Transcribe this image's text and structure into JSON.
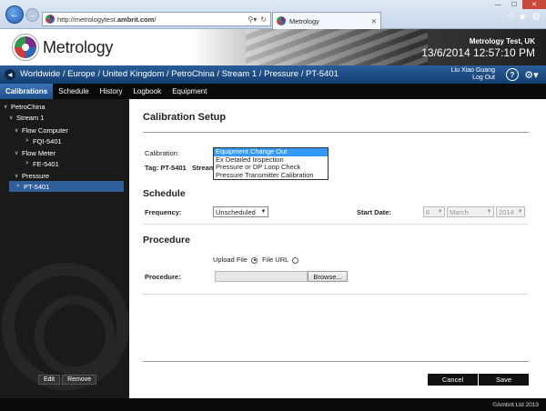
{
  "browser": {
    "url_prefix": "http://metrologytest.",
    "url_domain": "ambrit.com",
    "url_suffix": "/",
    "tab_title": "Metrology"
  },
  "header": {
    "logo_text": "Metrology",
    "site_name": "Metrology Test, UK",
    "datetime": "13/6/2014  12:57:10 PM"
  },
  "breadcrumb": {
    "path": "Worldwide / Europe / United Kingdom / PetroChina / Stream 1 / Pressure / PT-5401"
  },
  "user": {
    "name": "Liu Xiao Guang",
    "logout": "Log Out"
  },
  "nav": {
    "tabs": [
      "Calibrations",
      "Schedule",
      "History",
      "Logbook",
      "Equipment"
    ]
  },
  "tree": {
    "items": [
      {
        "label": "PetroChina",
        "chev": "∨"
      },
      {
        "label": "Stream 1",
        "chev": "∨"
      },
      {
        "label": "Flow Computer",
        "chev": "∨"
      },
      {
        "label": "FQI-5401",
        "chev": ">"
      },
      {
        "label": "Flow Meter",
        "chev": "∨"
      },
      {
        "label": "FE-5401",
        "chev": ">"
      },
      {
        "label": "Pressure",
        "chev": "∨"
      },
      {
        "label": "PT-5401",
        "chev": ">"
      }
    ],
    "edit_label": "Edit",
    "remove_label": "Remove"
  },
  "form": {
    "title": "Calibration Setup",
    "calibration_label": "Calibration:",
    "calibration_options": [
      "Equipment Change Out",
      "Ex Detailed Inspection",
      "Pressure or DP Loop Check",
      "Pressure Transmitter Calibration"
    ],
    "tag_text": "Tag: PT-5401",
    "stream_text": "Stream",
    "schedule_title": "Schedule",
    "frequency_label": "Frequency:",
    "frequency_value": "Unscheduled",
    "start_date_label": "Start Date:",
    "start_day": "6",
    "start_month": "March",
    "start_year": "2014",
    "procedure_title": "Procedure",
    "upload_file_label": "Upload File",
    "file_url_label": "File URL",
    "procedure_label": "Procedure:",
    "browse_label": "Browse...",
    "cancel_label": "Cancel",
    "save_label": "Save"
  },
  "footer": {
    "copyright": "©Ambrit Ltd 2013"
  }
}
